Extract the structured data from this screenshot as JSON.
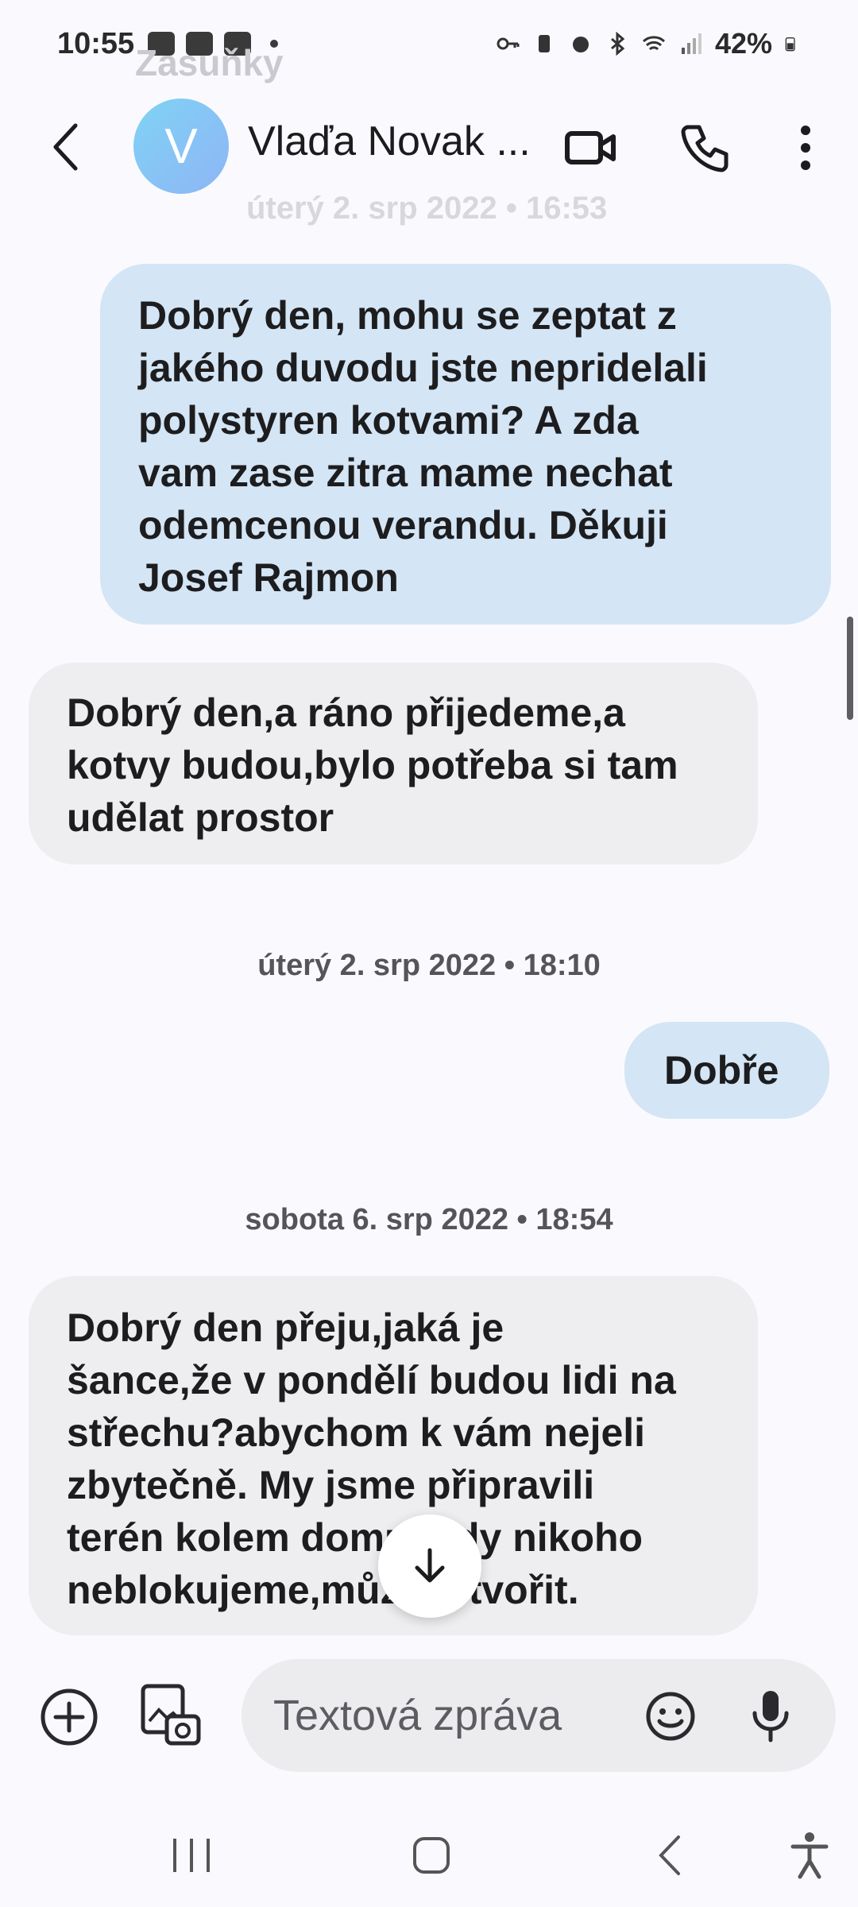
{
  "status_bar": {
    "time": "10:55",
    "battery": "42%"
  },
  "header": {
    "avatar_letter": "V",
    "contact_name": "Vlaďa Novak ...",
    "ghost_top": "Zasuňky",
    "ghost_date": "úterý 2. srp 2022 • 16:53"
  },
  "messages": [
    {
      "type": "sent",
      "text": "Dobrý den,  mohu se zeptat z\njakého duvodu jste nepridelali\npolystyren kotvami? A zda\nvam zase zitra mame nechat\nodemcenou verandu. Děkuji\nJosef Rajmon"
    },
    {
      "type": "received",
      "text": "Dobrý den,a ráno přijedeme,a\nkotvy budou,bylo potřeba si tam\nudělat prostor"
    },
    {
      "type": "timestamp",
      "text": "úterý 2. srp 2022 • 18:10"
    },
    {
      "type": "sent",
      "text": "Dobře"
    },
    {
      "type": "timestamp",
      "text": "sobota 6. srp 2022 • 18:54"
    },
    {
      "type": "received",
      "text": "Dobrý den přeju,jaká je\nšance,že v pondělí budou lidi na\nstřechu?abychom k vám nejeli\nzbytečně. My jsme připravili\nterén kolem domu,tedy nikoho\nneblokujeme,můžete tvořit."
    }
  ],
  "composer": {
    "placeholder": "Textová zpráva"
  },
  "colors": {
    "sent_bubble": "#d4e5f5",
    "received_bubble": "#eeeef1",
    "background": "#fafafe"
  }
}
